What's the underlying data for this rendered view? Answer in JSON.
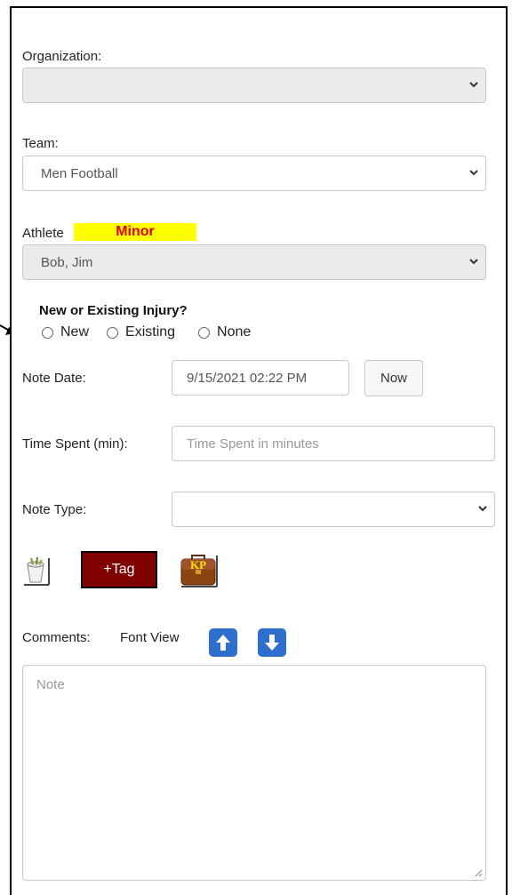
{
  "organization": {
    "label": "Organization:",
    "value": ""
  },
  "team": {
    "label": "Team:",
    "value": "Men Football"
  },
  "athlete": {
    "label": "Athlete",
    "badge": "Minor",
    "value": "Bob, Jim"
  },
  "injury": {
    "question": "New or Existing Injury?",
    "options": [
      "New",
      "Existing",
      "None"
    ]
  },
  "note_date": {
    "label": "Note Date:",
    "value": "9/15/2021 02:22 PM",
    "now_label": "Now"
  },
  "time_spent": {
    "label": "Time Spent (min):",
    "placeholder": "Time Spent in minutes"
  },
  "note_type": {
    "label": "Note Type:",
    "value": ""
  },
  "toolbar": {
    "tag_label": "+Tag",
    "kp_label": "KP",
    "icons": [
      "bucket-icon",
      "briefcase-kp-icon"
    ]
  },
  "comments": {
    "label": "Comments:",
    "font_view_label": "Font View",
    "placeholder": "Note",
    "icons": [
      "arrow-up-icon",
      "arrow-down-icon"
    ]
  },
  "colors": {
    "minor_bg": "#ffff00",
    "minor_text": "#e00000",
    "tag_bg": "#800000",
    "arrow_btn": "#2e6fce"
  }
}
